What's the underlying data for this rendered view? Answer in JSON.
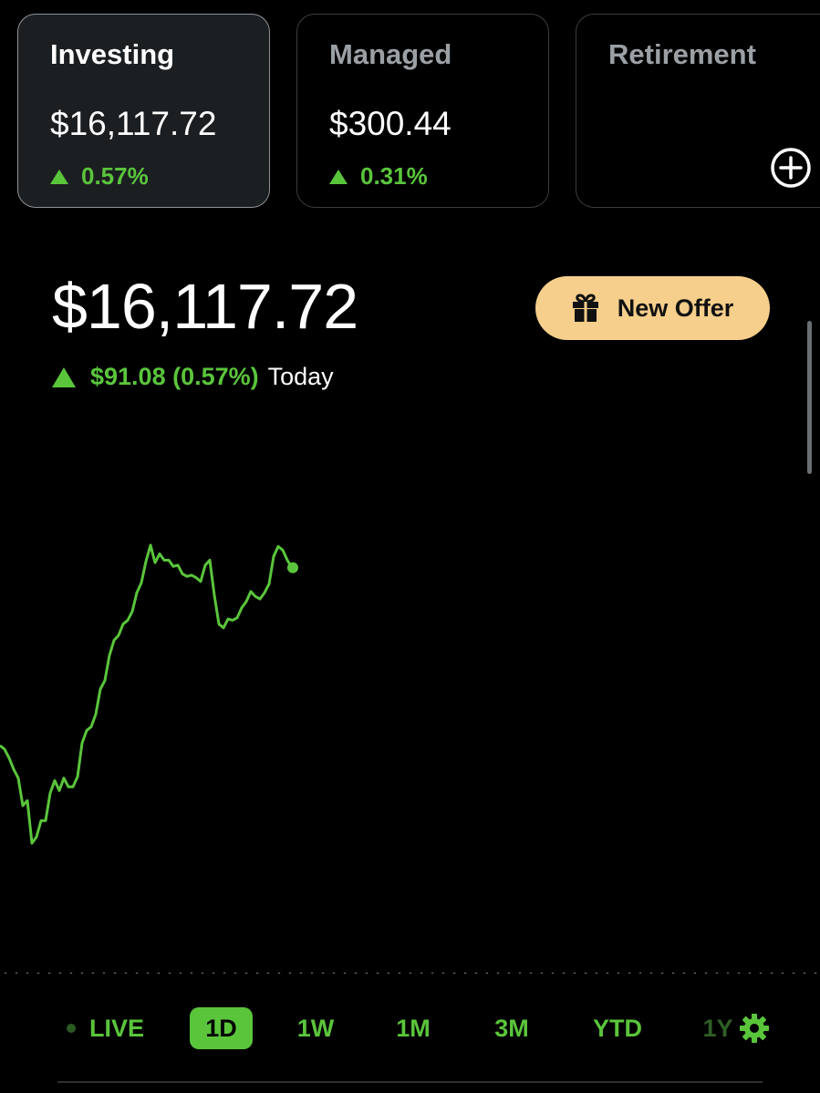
{
  "accounts": [
    {
      "title": "Investing",
      "value": "$16,117.72",
      "change": "0.57%",
      "active": true
    },
    {
      "title": "Managed",
      "value": "$300.44",
      "change": "0.31%",
      "active": false
    },
    {
      "title": "Retirement",
      "value": "",
      "change": "",
      "active": false,
      "icon": "plus-circle-icon"
    }
  ],
  "portfolio": {
    "value": "$16,117.72",
    "change_amount": "$91.08 (0.57%)",
    "change_period": "Today"
  },
  "offer_button": {
    "label": "New Offer",
    "icon": "gift-icon"
  },
  "colors": {
    "accent": "#5ac53b",
    "offer": "#f5cf8b",
    "background": "#000000"
  },
  "ranges": {
    "live": "LIVE",
    "items": [
      "1D",
      "1W",
      "1M",
      "3M",
      "YTD",
      "1Y"
    ],
    "selected": "1D",
    "settings_icon": "gear-icon"
  },
  "chart_data": {
    "type": "line",
    "title": "",
    "xlabel": "",
    "ylabel": "",
    "grid": false,
    "series": [
      {
        "values": [
          15988,
          15985,
          15978,
          15969,
          15962,
          15940,
          15944,
          15910,
          15915,
          15928,
          15928,
          15950,
          15960,
          15952,
          15962,
          15955,
          15955,
          15963,
          15990,
          16000,
          16003,
          16013,
          16033,
          16040,
          16060,
          16072,
          16076,
          16085,
          16088,
          16095,
          16110,
          16118,
          16135,
          16148,
          16134,
          16141,
          16136,
          16136,
          16131,
          16132,
          16125,
          16123,
          16124,
          16122,
          16119,
          16132,
          16136,
          16108,
          16085,
          16082,
          16089,
          16088,
          16090,
          16098,
          16103,
          16111,
          16107,
          16105,
          16110,
          16117,
          16139,
          16147,
          16144,
          16136,
          16130
        ]
      }
    ]
  }
}
